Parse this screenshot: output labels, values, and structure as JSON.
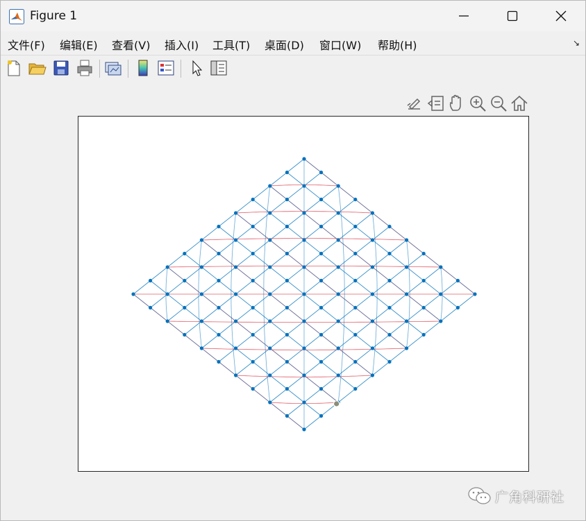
{
  "window": {
    "title": "Figure 1",
    "controls": [
      "minimize",
      "maximize",
      "close"
    ]
  },
  "menubar": {
    "items": [
      {
        "label": "文件(F)"
      },
      {
        "label": "编辑(E)"
      },
      {
        "label": "查看(V)"
      },
      {
        "label": "插入(I)"
      },
      {
        "label": "工具(T)"
      },
      {
        "label": "桌面(D)"
      },
      {
        "label": "窗口(W)"
      },
      {
        "label": "帮助(H)"
      }
    ]
  },
  "toolbar": {
    "tools": [
      "new-figure-icon",
      "open-folder-icon",
      "save-icon",
      "print-icon",
      "link-plot-icon",
      "colorbar-icon",
      "legend-icon",
      "pointer-icon",
      "property-inspector-icon"
    ]
  },
  "axes_toolbar": {
    "tools": [
      "brush-icon",
      "data-tips-icon",
      "pan-hand-icon",
      "zoom-in-icon",
      "zoom-out-icon",
      "home-icon"
    ]
  },
  "plot": {
    "grid_n": 10,
    "blue": "#0072bd",
    "red": "#d42a36",
    "point_color": "#0072bd",
    "highlight_color": "#8c8c7a"
  },
  "watermark": {
    "text": "广角科研社",
    "icon": "wechat-icon"
  }
}
